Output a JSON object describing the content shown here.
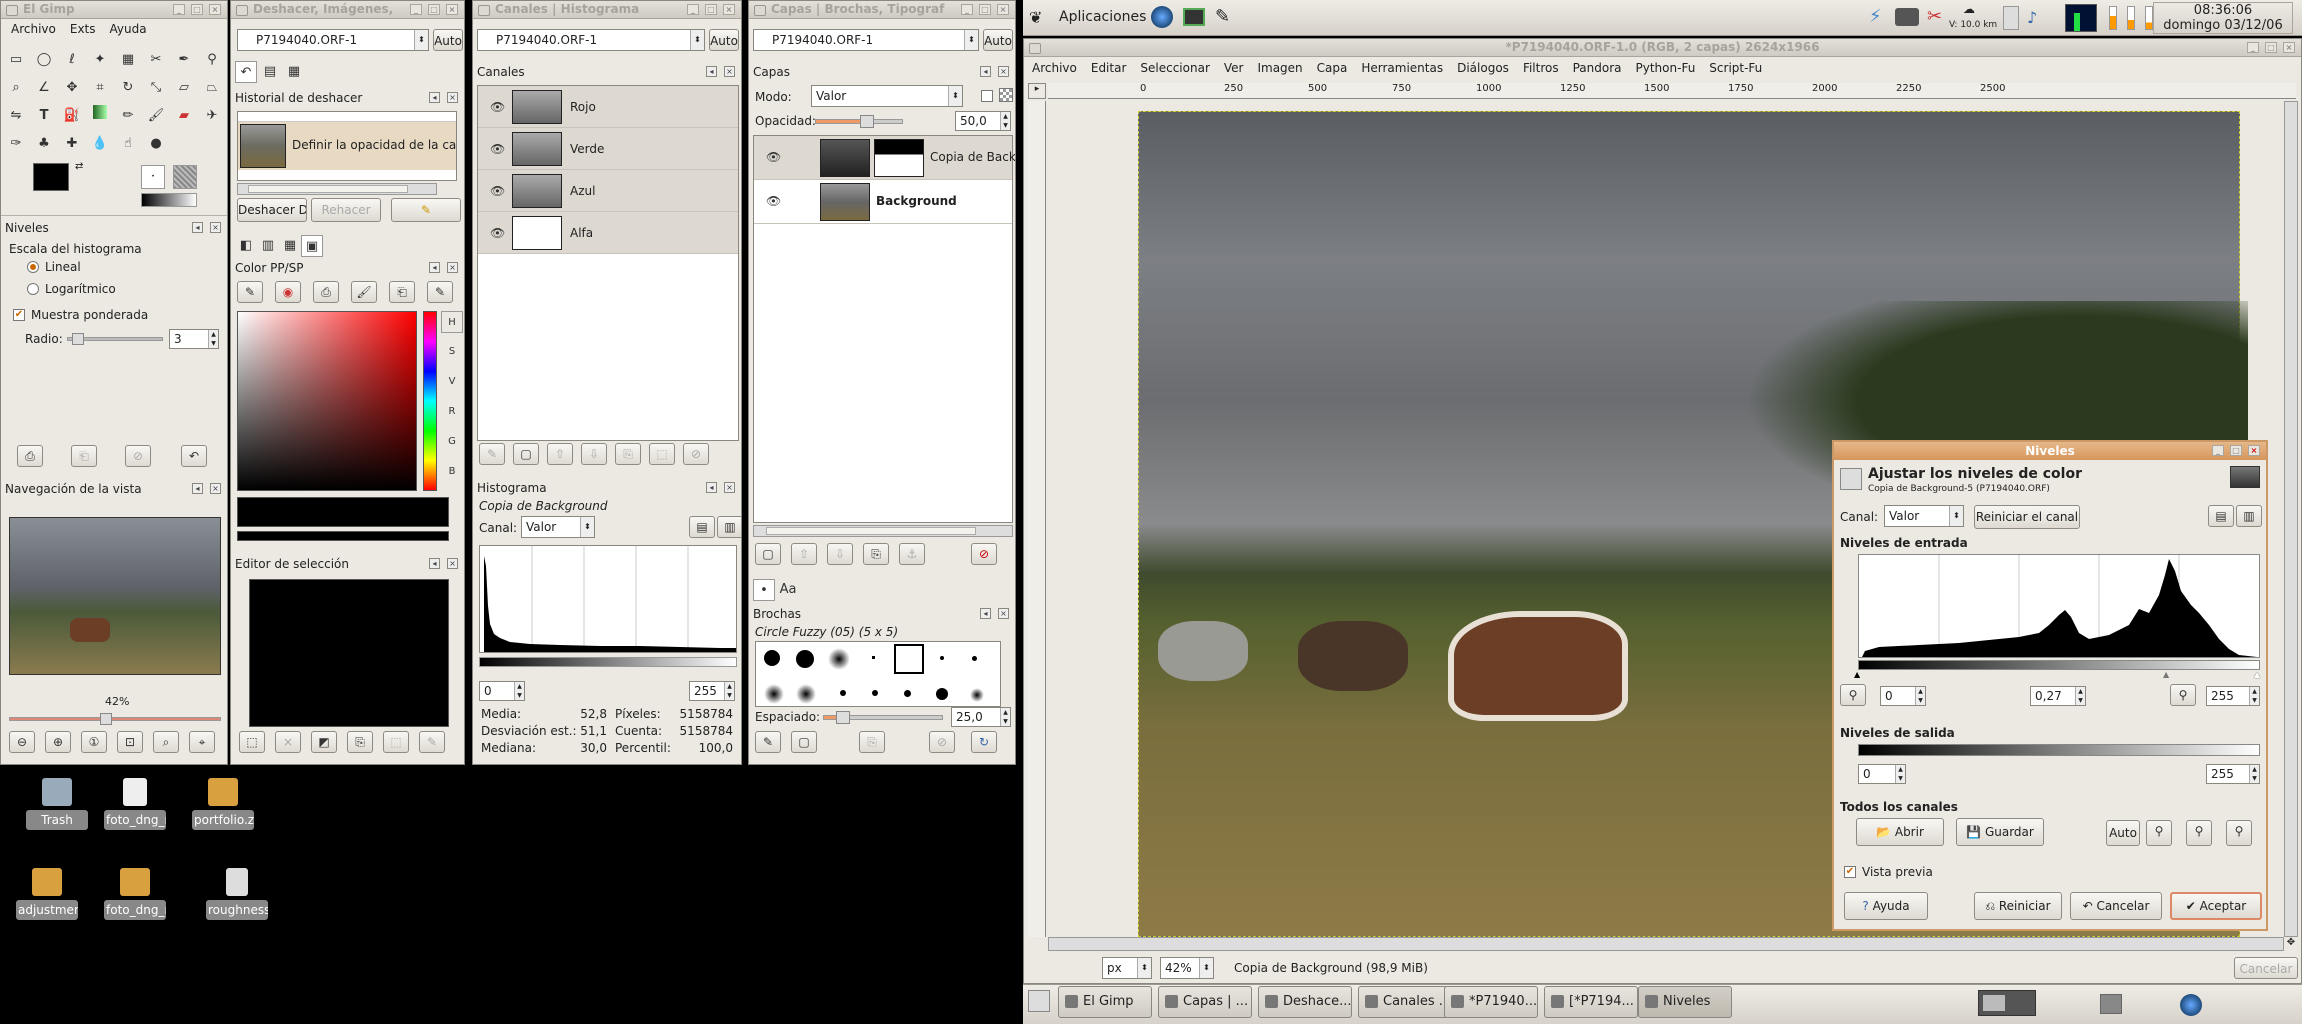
{
  "panel": {
    "apps": "Aplicaciones",
    "temp": "V: 10.0 km",
    "time": "08:36:06",
    "date": "domingo 03/12/06"
  },
  "toolbox": {
    "title": "El Gimp",
    "menu": [
      "Archivo",
      "Exts",
      "Ayuda"
    ]
  },
  "levels_tool": {
    "title": "Niveles",
    "hist_scale": "Escala del histograma",
    "linear": "Lineal",
    "log": "Logarítmico",
    "weighted": "Muestra ponderada",
    "radius_label": "Radio:",
    "radius_value": "3"
  },
  "nav": {
    "title": "Navegación de la vista",
    "zoom": "42%"
  },
  "undo": {
    "title": "Deshacer, Imágenes,",
    "image": "P7194040.ORF-1",
    "auto": "Auto",
    "history_title": "Historial de deshacer",
    "entry": "Definir la opacidad de la ca",
    "undo_btn": "Deshacer D",
    "redo_btn": "Rehacer"
  },
  "fg_bg": {
    "title": "Color PP/SP"
  },
  "sel_editor": {
    "title": "Editor de selección"
  },
  "channels": {
    "title": "Canales | Histograma",
    "image": "P7194040.ORF-1",
    "auto": "Auto",
    "header": "Canales",
    "items": [
      "Rojo",
      "Verde",
      "Azul",
      "Alfa"
    ]
  },
  "histogram": {
    "title": "Histograma",
    "layer": "Copia de Background",
    "channel_label": "Canal:",
    "channel": "Valor",
    "min": "0",
    "max": "255",
    "mean_l": "Media:",
    "mean": "52,8",
    "std_l": "Desviación est.:",
    "std": "51,1",
    "median_l": "Mediana:",
    "median": "30,0",
    "pixels_l": "Píxeles:",
    "pixels": "5158784",
    "count_l": "Cuenta:",
    "count": "5158784",
    "pct_l": "Percentil:",
    "pct": "100,0"
  },
  "layers": {
    "title": "Capas | Brochas, Tipograf",
    "image": "P7194040.ORF-1",
    "auto": "Auto",
    "header": "Capas",
    "mode_label": "Modo:",
    "mode": "Valor",
    "opacity_label": "Opacidad:",
    "opacity": "50,0",
    "items": [
      "Copia de Backgr",
      "Background"
    ]
  },
  "brushes": {
    "header": "Brochas",
    "name": "Circle Fuzzy (05) (5 x 5)",
    "spacing_label": "Espaciado:",
    "spacing": "25,0"
  },
  "image_win": {
    "title": "*P7194040.ORF-1.0 (RGB, 2 capas) 2624x1966",
    "menu": [
      "Archivo",
      "Editar",
      "Seleccionar",
      "Ver",
      "Imagen",
      "Capa",
      "Herramientas",
      "Diálogos",
      "Filtros",
      "Pandora",
      "Python-Fu",
      "Script-Fu"
    ],
    "ruler": [
      "0",
      "250",
      "500",
      "750",
      "1000",
      "1250",
      "1500",
      "1750",
      "2000",
      "2250",
      "2500"
    ],
    "unit": "px",
    "zoom": "42%",
    "status": "Copia de Background (98,9 MiB)",
    "cancel": "Cancelar"
  },
  "dialog": {
    "title": "Niveles",
    "heading": "Ajustar los niveles de color",
    "sub": "Copia de Background-5 (P7194040.ORF)",
    "channel_label": "Canal:",
    "channel": "Valor",
    "reset_channel": "Reiniciar el canal",
    "input": "Niveles de entrada",
    "in_low": "0",
    "gamma": "0,27",
    "in_high": "255",
    "output": "Niveles de salida",
    "out_low": "0",
    "out_high": "255",
    "all": "Todos los canales",
    "open": "Abrir",
    "save": "Guardar",
    "auto": "Auto",
    "preview": "Vista previa",
    "help": "Ayuda",
    "reset": "Reiniciar",
    "cancel": "Cancelar",
    "ok": "Aceptar"
  },
  "desktop": [
    "Trash",
    "foto_dng_n...",
    "portfolio.zip",
    "adjustmen...",
    "foto_dng_n...",
    "roughness"
  ],
  "taskbar": [
    "El Gimp",
    "Capas | ...",
    "Deshace...",
    "Canales ...",
    "*P71940...",
    "[*P7194...",
    "Niveles"
  ]
}
